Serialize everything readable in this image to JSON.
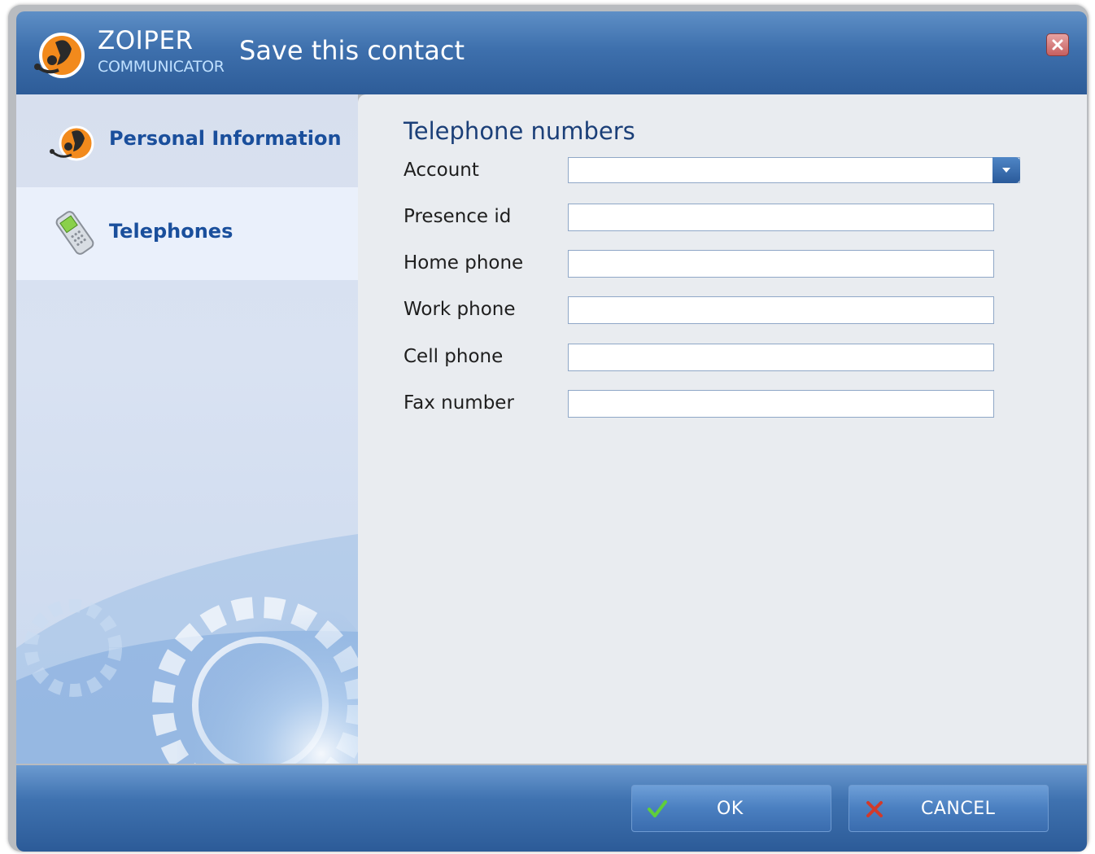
{
  "app": {
    "brand_name": "ZOIPER",
    "brand_sub": "COMMUNICATOR",
    "dialog_title": "Save this contact"
  },
  "sidebar": {
    "items": [
      {
        "label": "Personal Information",
        "icon": "headset-person-icon",
        "active": false
      },
      {
        "label": "Telephones",
        "icon": "mobile-phone-icon",
        "active": true
      }
    ]
  },
  "form": {
    "section_title": "Telephone numbers",
    "account": {
      "label": "Account",
      "value": ""
    },
    "fields": [
      {
        "label": "Presence id",
        "value": ""
      },
      {
        "label": "Home phone",
        "value": ""
      },
      {
        "label": "Work phone",
        "value": ""
      },
      {
        "label": "Cell phone",
        "value": ""
      },
      {
        "label": "Fax number",
        "value": ""
      }
    ]
  },
  "buttons": {
    "ok_label": "OK",
    "cancel_label": "CANCEL"
  },
  "colors": {
    "accent": "#3e70ad",
    "link": "#1a4f9c",
    "ok_check": "#5fcf3a",
    "cancel_x": "#d23a2a"
  }
}
